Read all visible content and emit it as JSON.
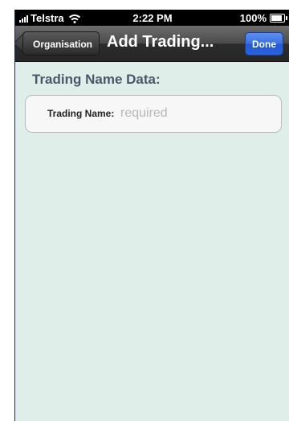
{
  "status_bar": {
    "carrier": "Telstra",
    "time": "2:22 PM",
    "battery_text": "100%",
    "battery_level": 1.0,
    "signal_bars": 4
  },
  "nav_bar": {
    "back_label": "Organisation",
    "title": "Add Trading...",
    "done_label": "Done"
  },
  "form": {
    "section_header": "Trading Name Data:",
    "field_label": "Trading Name:",
    "field_value": "",
    "field_placeholder": "required"
  },
  "colors": {
    "background": "#dfeee8",
    "section_header": "#4c566a",
    "done_button": "#2a62dc"
  }
}
